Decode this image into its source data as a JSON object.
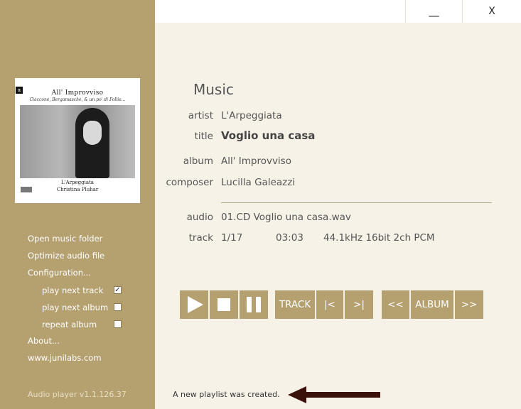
{
  "window": {
    "minimize_label": "__",
    "close_label": "X"
  },
  "cover": {
    "title": "All' Improvviso",
    "subtitle": "Ciaccone, Bergamasche, & un po' di Follie...",
    "artist": "L'Arpeggiata",
    "performer": "Christina Pluhar",
    "label_mark": "α"
  },
  "sidebar": {
    "menu": [
      {
        "label": "Open music folder"
      },
      {
        "label": "Optimize audio file"
      },
      {
        "label": "Configuration..."
      }
    ],
    "options": [
      {
        "label": "play next track",
        "checked": true
      },
      {
        "label": "play next album",
        "checked": false
      },
      {
        "label": "repeat album",
        "checked": false
      }
    ],
    "about_label": "About...",
    "website_label": "www.junilabs.com",
    "version": "Audio player v1.1.126.37"
  },
  "info": {
    "section_title": "Music",
    "artist_label": "artist",
    "artist": "L'Arpeggiata",
    "title_label": "title",
    "title": "Voglio una casa",
    "album_label": "album",
    "album": "All' Improvviso",
    "composer_label": "composer",
    "composer": "Lucilla Galeazzi",
    "audio_label": "audio",
    "audio": "01.CD Voglio una casa.wav",
    "track_label": "track",
    "track_number": "1/17",
    "duration": "03:03",
    "format": "44.1kHz 16bit 2ch PCM"
  },
  "controls": {
    "track_label": "TRACK",
    "prev_track_label": "|<",
    "next_track_label": ">|",
    "prev_album_label": "<<",
    "album_label": "ALBUM",
    "next_album_label": ">>",
    "accent_color": "#b5a070"
  },
  "status": {
    "message": "A new playlist was created."
  }
}
